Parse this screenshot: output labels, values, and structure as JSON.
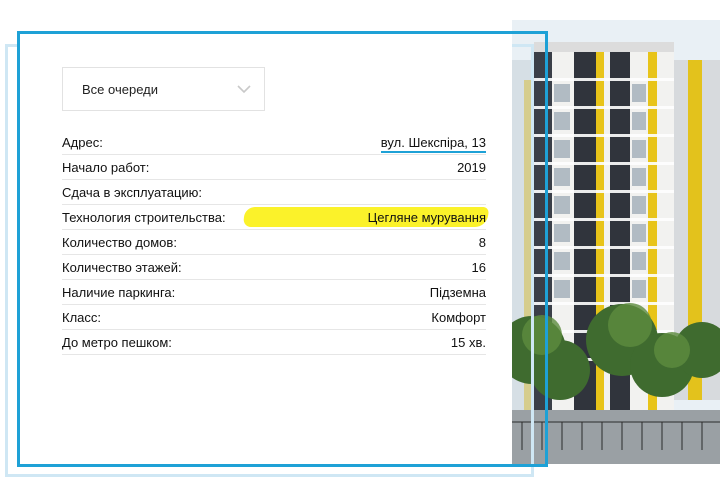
{
  "queue_select": {
    "selected": "Все очереди"
  },
  "details": [
    {
      "label": "Адрес:",
      "value": "вул. Шекспіра, 13"
    },
    {
      "label": "Начало работ:",
      "value": "2019"
    },
    {
      "label": "Сдача в эксплуатацию:",
      "value": ""
    },
    {
      "label": "Технология строительства:",
      "value": "Цегляне мурування"
    },
    {
      "label": "Количество домов:",
      "value": "8"
    },
    {
      "label": "Количество этажей:",
      "value": "16"
    },
    {
      "label": "Наличие паркинга:",
      "value": "Підземна"
    },
    {
      "label": "Класс:",
      "value": "Комфорт"
    },
    {
      "label": "До метро пешком:",
      "value": "15 хв."
    }
  ],
  "colors": {
    "accent": "#1ea1d6",
    "highlight": "#fbf22a",
    "facade_yellow": "#e8c419",
    "facade_dark": "#2c3038"
  },
  "icons": {
    "dropdown": "chevron-down-icon"
  }
}
